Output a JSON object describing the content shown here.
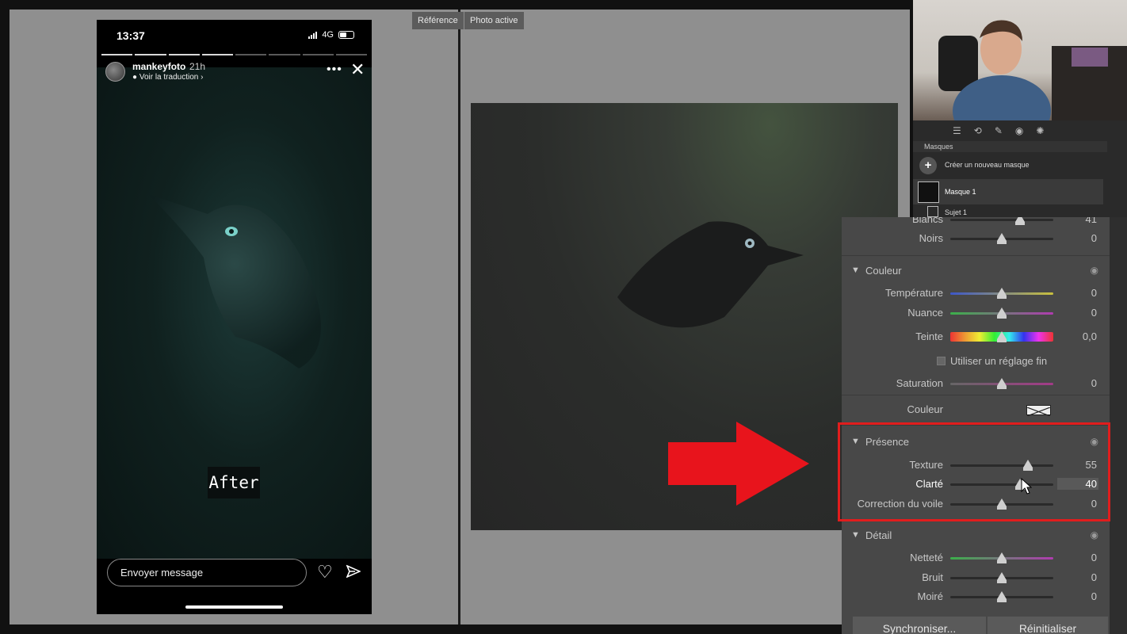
{
  "workspace": {
    "reference_tag": "Référence",
    "active_tag": "Photo active"
  },
  "story": {
    "time": "13:37",
    "network": "4G",
    "username": "mankeyfoto",
    "posted": "21h",
    "translate": "Voir la traduction",
    "caption": "After",
    "message_placeholder": "Envoyer message",
    "progress_segments": 8,
    "progress_done": 4
  },
  "masks": {
    "header": "Masques",
    "create": "Créer un nouveau masque",
    "mask_name": "Masque 1",
    "subject_name": "Sujet 1"
  },
  "panel": {
    "top_rows": [
      {
        "label": "Blancs",
        "value": "41",
        "pos": 0.68
      },
      {
        "label": "Noirs",
        "value": "0",
        "pos": 0.5
      }
    ],
    "couleur": {
      "title": "Couleur",
      "rows": [
        {
          "label": "Température",
          "value": "0",
          "pos": 0.5,
          "kind": "temp"
        },
        {
          "label": "Nuance",
          "value": "0",
          "pos": 0.5,
          "kind": "tint"
        },
        {
          "label": "Teinte",
          "value": "0,0",
          "pos": 0.5,
          "kind": "hue"
        }
      ],
      "fine": "Utiliser un réglage fin",
      "saturation": {
        "label": "Saturation",
        "value": "0",
        "pos": 0.5
      },
      "color_label": "Couleur"
    },
    "presence": {
      "title": "Présence",
      "rows": [
        {
          "label": "Texture",
          "value": "55",
          "pos": 0.75
        },
        {
          "label": "Clarté",
          "value": "40",
          "pos": 0.68
        },
        {
          "label": "Correction du voile",
          "value": "0",
          "pos": 0.5
        }
      ]
    },
    "detail": {
      "title": "Détail",
      "rows": [
        {
          "label": "Netteté",
          "value": "0",
          "pos": 0.5
        },
        {
          "label": "Bruit",
          "value": "0",
          "pos": 0.5
        },
        {
          "label": "Moiré",
          "value": "0",
          "pos": 0.5
        }
      ]
    },
    "sync_button": "Synchroniser...",
    "reset_button": "Réinitialiser"
  },
  "colors": {
    "highlight": "#e11d1d",
    "arrow": "#e8141c"
  }
}
